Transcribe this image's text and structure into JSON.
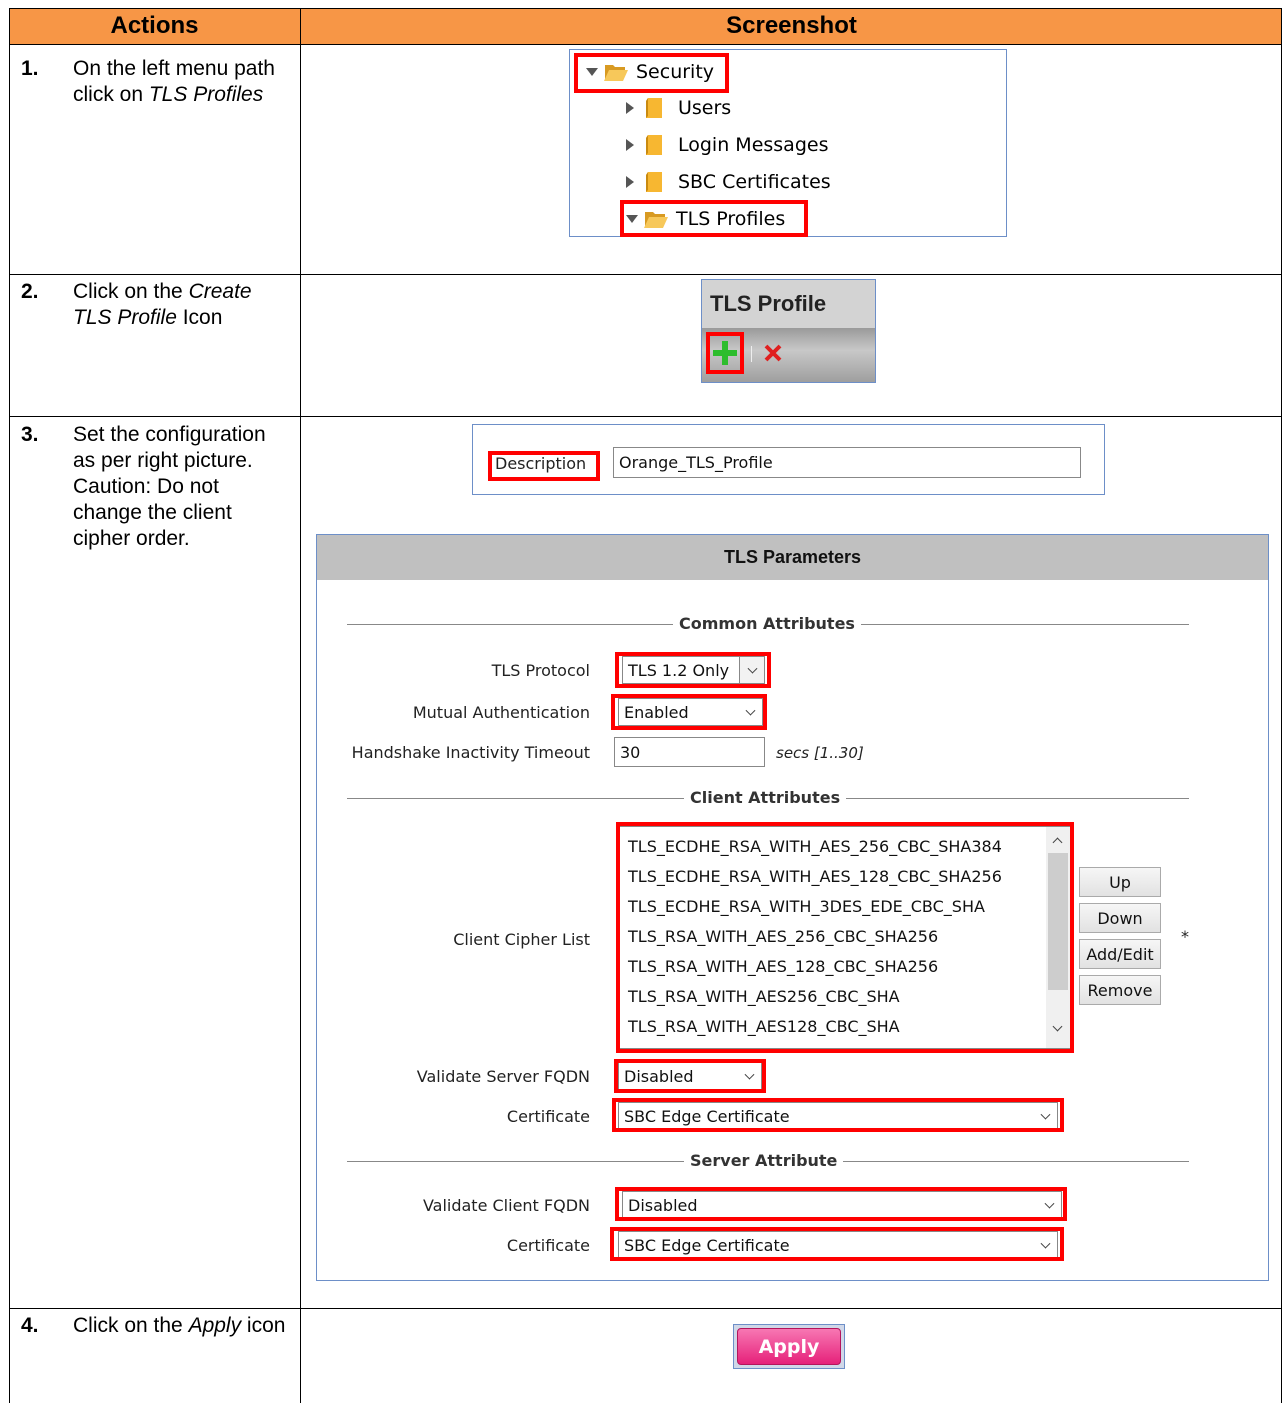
{
  "header": {
    "actions": "Actions",
    "screenshot": "Screenshot"
  },
  "steps": [
    {
      "num": "1.",
      "text_a": "On the left menu path click on ",
      "text_b": "TLS Profiles",
      "text_c": ""
    },
    {
      "num": "2.",
      "text_a": "Click on the ",
      "text_b": "Create TLS Profile",
      "text_c": " Icon"
    },
    {
      "num": "3.",
      "text_a": "Set the configuration as per right picture. Caution: Do not change the client cipher order.",
      "text_b": "",
      "text_c": ""
    },
    {
      "num": "4.",
      "text_a": "Click on the ",
      "text_b": "Apply",
      "text_c": " icon"
    }
  ],
  "tree": {
    "items": [
      "Security",
      "Users",
      "Login Messages",
      "SBC Certificates",
      "TLS Profiles"
    ]
  },
  "tls_profile_panel": {
    "title": "TLS Profile"
  },
  "description": {
    "label": "Description",
    "value": "Orange_TLS_Profile"
  },
  "tls_parameters": {
    "title": "TLS Parameters",
    "common_attributes": "Common Attributes",
    "tls_protocol_label": "TLS Protocol",
    "tls_protocol_value": "TLS 1.2 Only",
    "mutual_auth_label": "Mutual Authentication",
    "mutual_auth_value": "Enabled",
    "handshake_label": "Handshake Inactivity Timeout",
    "handshake_value": "30",
    "handshake_unit": "secs [1..30]",
    "client_attributes": "Client Attributes",
    "cipher_list_label": "Client Cipher List",
    "ciphers": [
      "TLS_ECDHE_RSA_WITH_AES_256_CBC_SHA384",
      "TLS_ECDHE_RSA_WITH_AES_128_CBC_SHA256",
      "TLS_ECDHE_RSA_WITH_3DES_EDE_CBC_SHA",
      "TLS_RSA_WITH_AES_256_CBC_SHA256",
      "TLS_RSA_WITH_AES_128_CBC_SHA256",
      "TLS_RSA_WITH_AES256_CBC_SHA",
      "TLS_RSA_WITH_AES128_CBC_SHA"
    ],
    "buttons": {
      "up": "Up",
      "down": "Down",
      "add_edit": "Add/Edit",
      "remove": "Remove"
    },
    "required_mark": "*",
    "validate_server_label": "Validate Server FQDN",
    "validate_server_value": "Disabled",
    "client_cert_label": "Certificate",
    "client_cert_value": "SBC Edge Certificate",
    "server_attribute": "Server Attribute",
    "validate_client_label": "Validate Client FQDN",
    "validate_client_value": "Disabled",
    "server_cert_label": "Certificate",
    "server_cert_value": "SBC Edge Certificate"
  },
  "apply_button": {
    "label": "Apply"
  },
  "colors": {
    "header": "#F79646",
    "highlight": "#FF0000",
    "apply": "#E6217A"
  }
}
